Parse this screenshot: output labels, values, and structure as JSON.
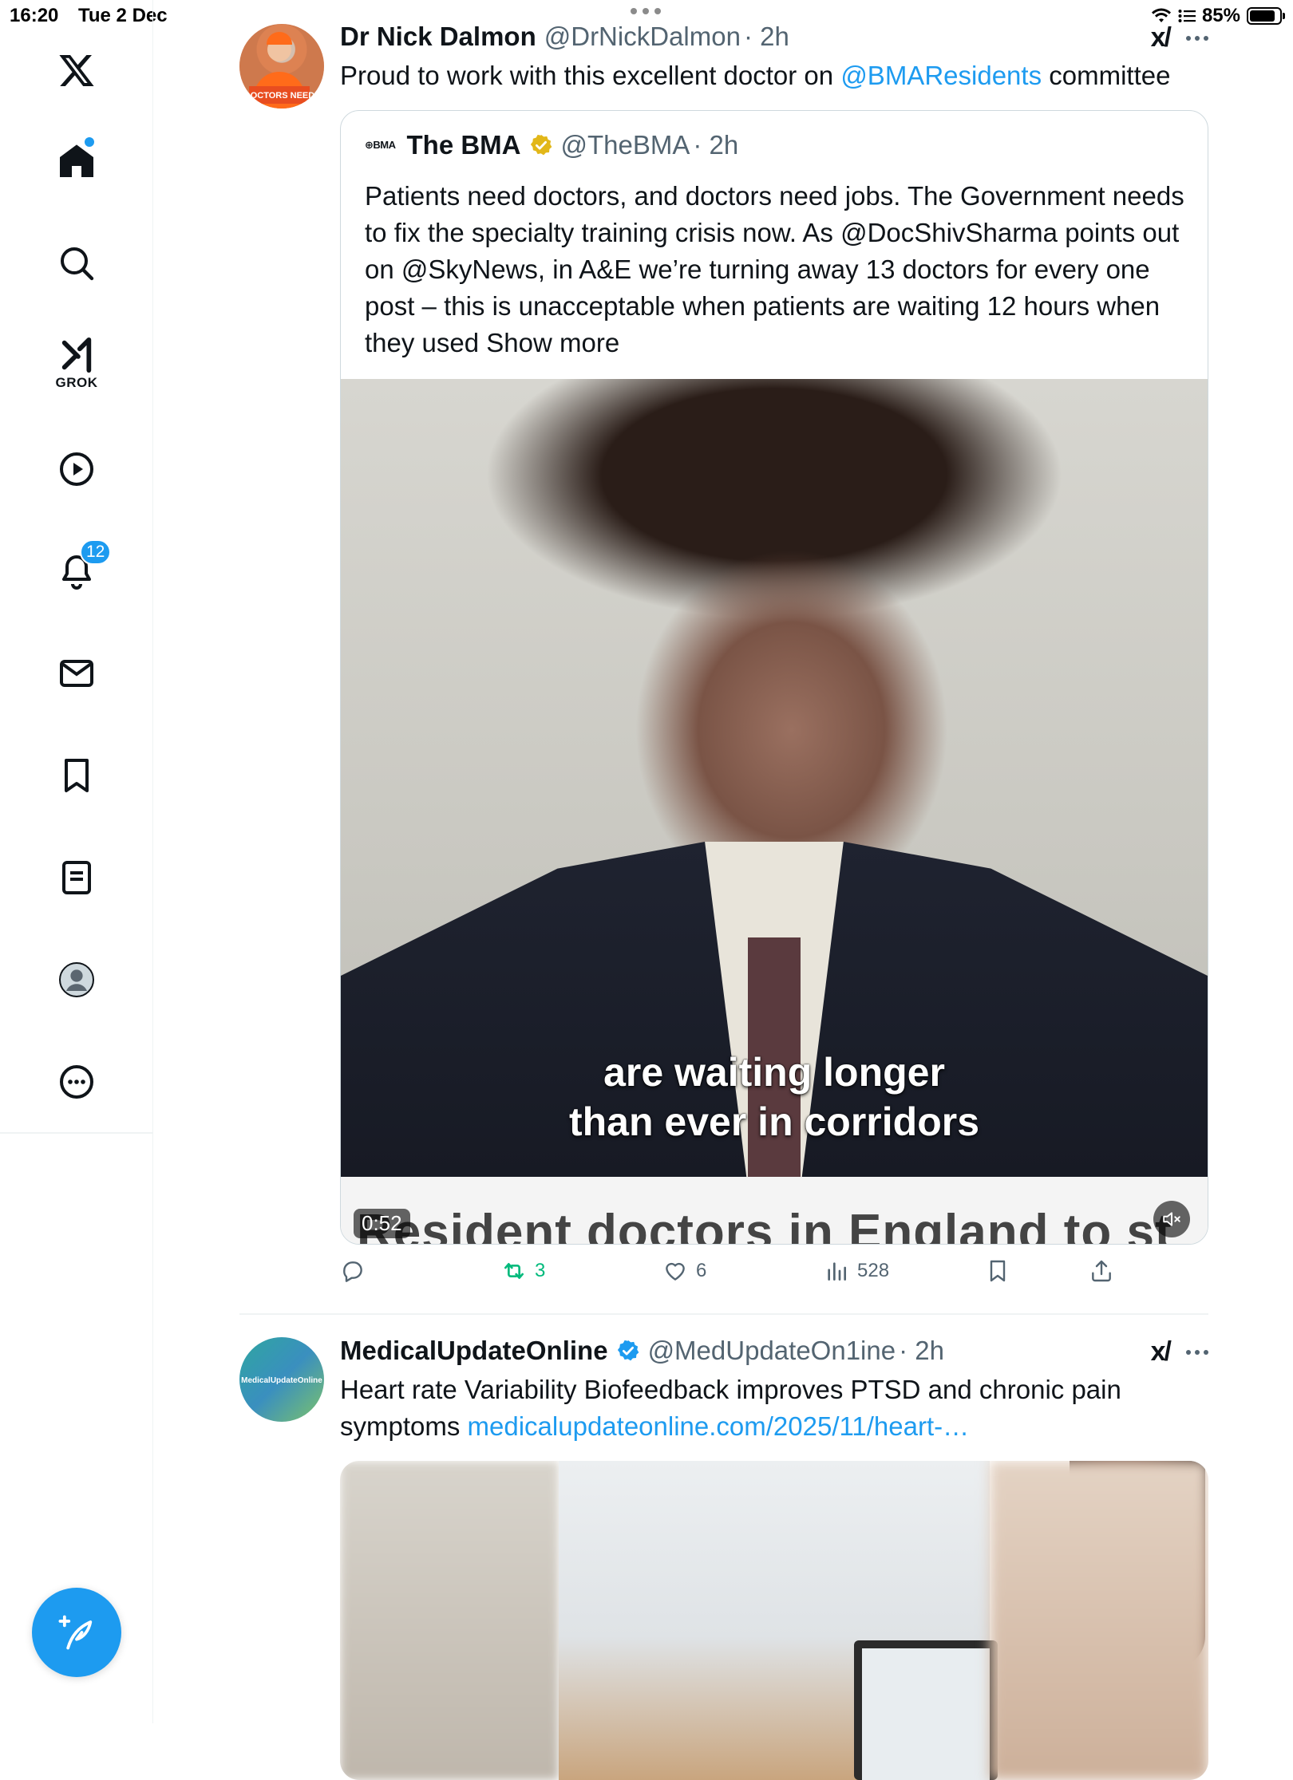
{
  "status_bar": {
    "time": "16:20",
    "date": "Tue 2 Dec",
    "battery": "85%",
    "battery_level": 0.85
  },
  "sidebar": {
    "items": [
      {
        "name": "home",
        "icon": "home-icon",
        "has_dot": true
      },
      {
        "name": "search",
        "icon": "search-icon"
      },
      {
        "name": "grok",
        "icon": "grok-icon",
        "label": "GROK"
      },
      {
        "name": "video",
        "icon": "play-icon"
      },
      {
        "name": "notifications",
        "icon": "bell-icon",
        "badge": "12"
      },
      {
        "name": "messages",
        "icon": "mail-icon"
      },
      {
        "name": "bookmarks",
        "icon": "bookmark-icon"
      },
      {
        "name": "lists",
        "icon": "list-icon"
      },
      {
        "name": "profile",
        "icon": "profile-icon"
      },
      {
        "name": "more",
        "icon": "more-circle-icon"
      }
    ],
    "compose_icon": "compose-icon"
  },
  "colors": {
    "accent": "#1d9bf0",
    "text": "#0f1419",
    "muted": "#536471",
    "retweet_active": "#00ba7c",
    "verified_gold": "#e2b719"
  },
  "tweets": [
    {
      "display_name": "Dr Nick Dalmon",
      "handle": "@DrNickDalmon",
      "time": "· 2h",
      "avatar_text": "DOCTORS NEED",
      "text_prefix": "Proud to work with this excellent doctor on ",
      "text_link": "@BMAResidents",
      "text_suffix": " committee",
      "quote": {
        "logo": "⊕BMA",
        "display_name": "The BMA",
        "handle": "@TheBMA",
        "time": "· 2h",
        "text": "Patients need doctors, and doctors need jobs. The Government needs to fix the specialty training crisis now. As @DocShivSharma points out on @SkyNews, in A&E we’re turning away 13 doctors for every one post – this is unacceptable when patients are waiting 12 hours when they used ",
        "show_more": "Show more",
        "video": {
          "caption_line1": "are waiting longer",
          "caption_line2": "than ever in corridors",
          "ticker": "Resident doctors in England to st",
          "duration": "0:52"
        }
      },
      "actions": {
        "reply": "",
        "retweets": "3",
        "likes": "6",
        "views": "528"
      }
    },
    {
      "display_name": "MedicalUpdateOnline",
      "handle": "@MedUpdateOn1ine",
      "time": "· 2h",
      "avatar_text": "MedicalUpdateOnline",
      "text_prefix": "Heart rate Variability Biofeedback improves PTSD and chronic pain symptoms ",
      "text_link": "medicalupdateonline.com/2025/11/heart-…",
      "text_suffix": ""
    }
  ]
}
